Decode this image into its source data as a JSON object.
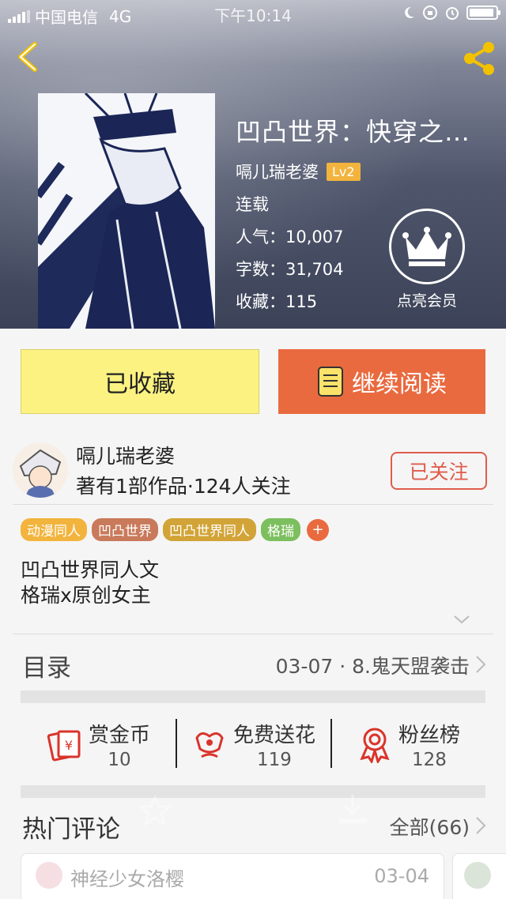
{
  "status_bar": {
    "carrier": "中国电信",
    "network": "4G",
    "time": "下午10:14",
    "overlay_time": "10/14"
  },
  "book": {
    "title": "凹凸世界：快穿之…",
    "author": "嗝儿瑞老婆",
    "author_level": "Lv2",
    "status": "连载",
    "popularity_label": "人气：",
    "popularity": "10,007",
    "word_count_label": "字数：",
    "word_count": "31,704",
    "favorites_label": "收藏：",
    "favorites": "115"
  },
  "vip": {
    "label": "点亮会员",
    "icon": "crown-icon"
  },
  "actions": {
    "collected_label": "已收藏",
    "continue_label": "继续阅读",
    "collected_color": "#fbf282",
    "continue_color": "#e96a3f"
  },
  "author_section": {
    "name": "嗝儿瑞老婆",
    "stats": "著有1部作品·124人关注",
    "follow_label": "已关注"
  },
  "tags": [
    {
      "label": "动漫同人",
      "color": "#f2b43d"
    },
    {
      "label": "凹凸世界",
      "color": "#c97a5b"
    },
    {
      "label": "凹凸世界同人",
      "color": "#d2a437"
    },
    {
      "label": "格瑞",
      "color": "#7cbf5e"
    }
  ],
  "tag_add_label": "+",
  "description": {
    "line1": "凹凸世界同人文",
    "line2": "格瑞x原创女主"
  },
  "toc": {
    "label": "目录",
    "latest": "03-07 · 8.鬼天盟袭击"
  },
  "stats": [
    {
      "label": "赏金币",
      "value": "10",
      "icon": "red-envelope-icon"
    },
    {
      "label": "免费送花",
      "value": "119",
      "icon": "flower-icon"
    },
    {
      "label": "粉丝榜",
      "value": "128",
      "icon": "medal-icon"
    }
  ],
  "comments": {
    "title": "热门评论",
    "all_label": "全部(66)",
    "items": [
      {
        "name": "神经少女洛樱",
        "date": "03-04"
      }
    ]
  }
}
